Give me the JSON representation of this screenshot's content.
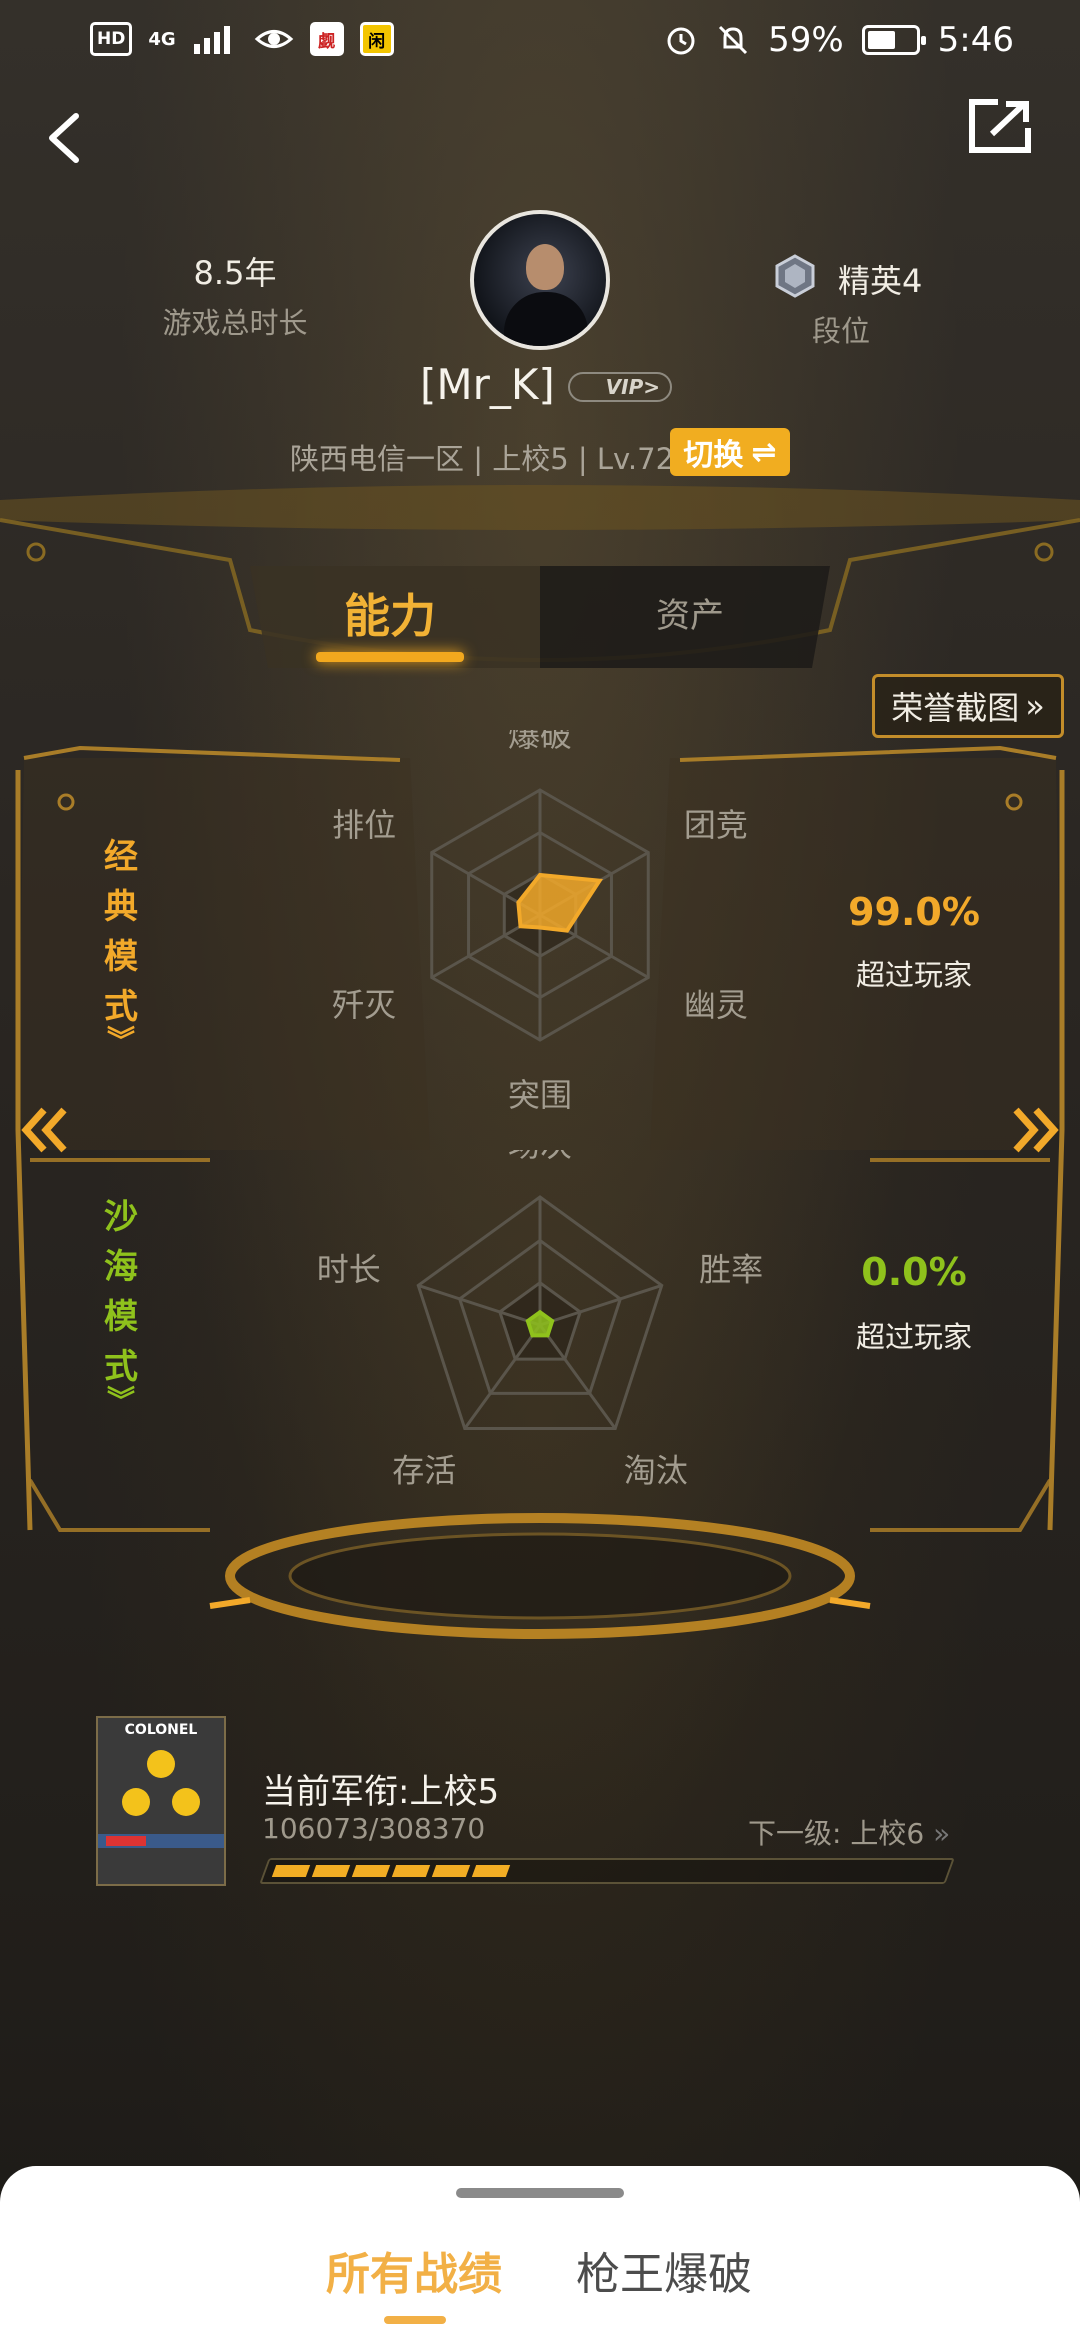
{
  "status_bar": {
    "hd": "HD",
    "network": "4G",
    "battery_pct": "59%",
    "battery_level": 0.59,
    "time": "5:46"
  },
  "profile": {
    "years_value": "8.5年",
    "years_label": "游戏总时长",
    "name": "[Mr_K]",
    "vip": "VIP",
    "rank_title": "精英4",
    "rank_label": "段位",
    "server_info": "陕西电信一区 | 上校5 | Lv.72",
    "switch_label": "切换"
  },
  "tabs": {
    "ability": "能力",
    "assets": "资产"
  },
  "honor_button": "荣誉截图",
  "classic_mode": {
    "title": [
      "经",
      "典",
      "模",
      "式"
    ],
    "percent": "99.0%",
    "exceed_label": "超过玩家",
    "axes": [
      "爆破",
      "团竞",
      "幽灵",
      "突围",
      "歼灭",
      "排位"
    ],
    "values": [
      0.32,
      0.55,
      0.25,
      0.1,
      0.18,
      0.2
    ],
    "color": "#f2a92a"
  },
  "desert_mode": {
    "title": [
      "沙",
      "海",
      "模",
      "式"
    ],
    "percent": "0.0%",
    "exceed_label": "超过玩家",
    "axes": [
      "场次",
      "胜率",
      "淘汰",
      "存活",
      "时长"
    ],
    "values": [
      0.1,
      0.1,
      0.1,
      0.1,
      0.1
    ],
    "color": "#8fc21c"
  },
  "military_rank": {
    "badge_text": "COLONEL",
    "current": "当前军衔:上校5",
    "progress_text": "106073/308370",
    "progress": 0.344,
    "next": "下一级: 上校6"
  },
  "bottom_tabs": {
    "all": "所有战绩",
    "sniper": "枪王爆破"
  }
}
